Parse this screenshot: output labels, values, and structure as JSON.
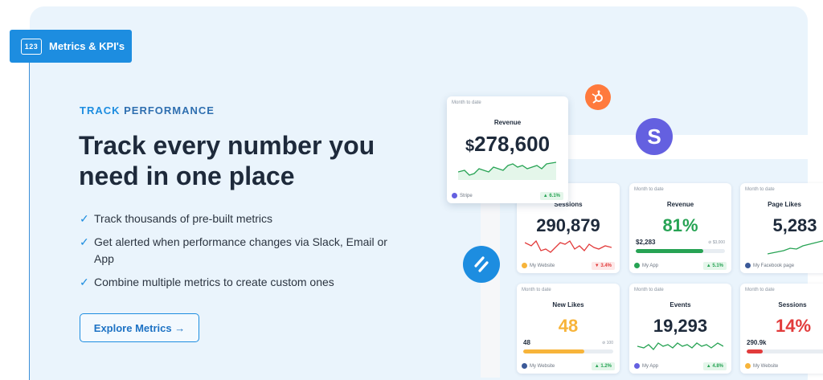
{
  "tag": {
    "icon_text": "123",
    "label": "Metrics & KPI's"
  },
  "eyebrow": {
    "bold": "TRACK",
    "rest": " PERFORMANCE"
  },
  "headline": "Track every number you need in one place",
  "features": [
    "Track thousands of pre-built metrics",
    "Get alerted when performance changes via Slack, Email or App",
    "Combine multiple metrics to create custom ones"
  ],
  "check_glyph": "✓",
  "cta_label": "Explore Metrics →",
  "colors": {
    "accent": "#1d8de0",
    "green": "#27a354",
    "red": "#e23b3b",
    "orange": "#f7b43a",
    "hubspot": "#ff7a3d",
    "stripe": "#6460e0",
    "helpscout": "#1d8de0"
  },
  "logos": {
    "stripe_letter": "S"
  },
  "cards": {
    "revenue_main": {
      "period": "Month to date",
      "title": "Revenue",
      "currency": "$",
      "value": "278,600",
      "source": "Stripe",
      "delta": "▲ 6.1%"
    },
    "sessions": {
      "title": "Sessions",
      "value": "290,879",
      "source": "My Website",
      "delta": "▼ 3.4%"
    },
    "revenue_goal": {
      "period": "Month to date",
      "title": "Revenue",
      "value": "81%",
      "current": "$2,283",
      "target": "$3,000",
      "progress": 0.76,
      "source": "My App",
      "delta": "▲ 5.1%"
    },
    "page_likes": {
      "period": "Month to date",
      "title": "Page Likes",
      "value": "5,283",
      "source": "My Facebook page"
    },
    "new_likes": {
      "period": "Month to date",
      "title": "New Likes",
      "value": "48",
      "current": "48",
      "target": "100",
      "progress": 0.68,
      "source": "My Website",
      "delta": "▲ 1.2%"
    },
    "events": {
      "period": "Month to date",
      "title": "Events",
      "value": "19,293",
      "source": "My App",
      "delta": "▲ 4.8%"
    },
    "sessions2": {
      "period": "Month to date",
      "title": "Sessions",
      "value": "14%",
      "current": "290.9k",
      "progress": 0.18,
      "source": "My Website"
    }
  }
}
